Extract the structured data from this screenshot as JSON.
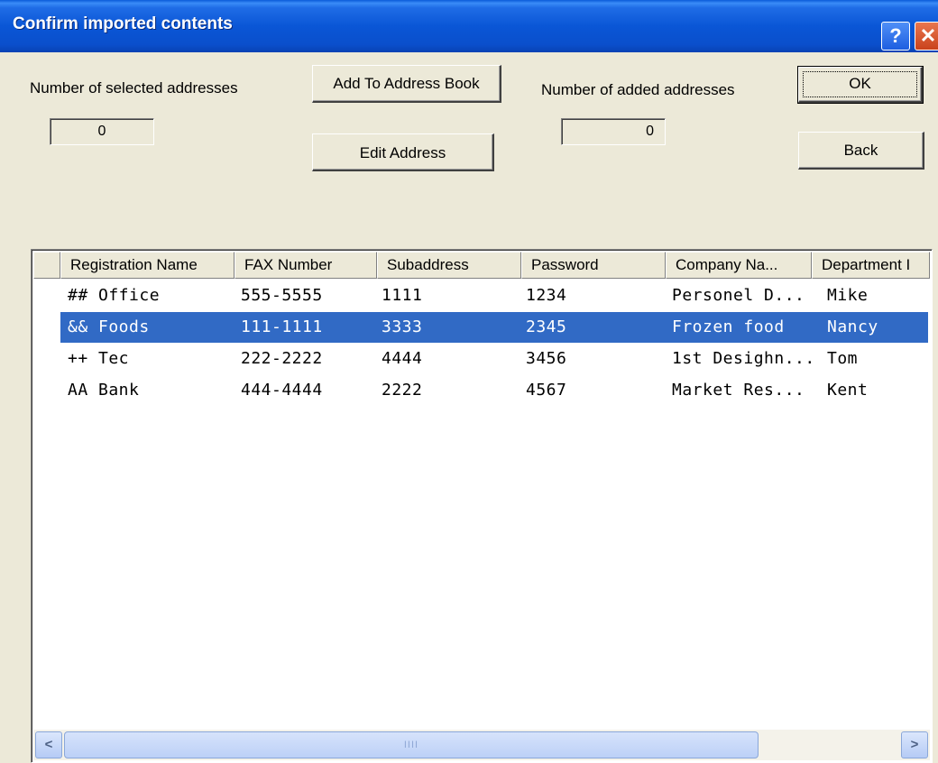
{
  "window": {
    "title": "Confirm imported contents",
    "help_glyph": "?",
    "close_glyph": "✕"
  },
  "labels": {
    "selected": "Number of selected addresses",
    "added": "Number of added addresses"
  },
  "counts": {
    "selected": "0",
    "added": "0"
  },
  "buttons": {
    "add": "Add To Address Book",
    "edit": "Edit Address",
    "ok": "OK",
    "back": "Back"
  },
  "table": {
    "columns": [
      "Registration Name",
      "FAX Number",
      "Subaddress",
      "Password",
      "Company Na...",
      "Department I"
    ],
    "rows": [
      {
        "name": "## Office",
        "fax": "555-5555",
        "sub": "1111",
        "pass": "1234",
        "company": "Personel D...",
        "dept": "Mike",
        "selected": false
      },
      {
        "name": "&& Foods",
        "fax": "111-1111",
        "sub": "3333",
        "pass": "2345",
        "company": "Frozen food",
        "dept": "Nancy",
        "selected": true
      },
      {
        "name": "++ Tec",
        "fax": "222-2222",
        "sub": "4444",
        "pass": "3456",
        "company": "1st Desighn...",
        "dept": "Tom",
        "selected": false
      },
      {
        "name": "AA Bank",
        "fax": "444-4444",
        "sub": "2222",
        "pass": "4567",
        "company": "Market Res...",
        "dept": "Kent",
        "selected": false
      }
    ]
  },
  "scrollbar": {
    "left_glyph": "<",
    "right_glyph": ">",
    "grip": "IIII"
  },
  "colors": {
    "title_bar": "#0a56d6",
    "selection": "#316ac5",
    "dialog_bg": "#ece9d8"
  },
  "icons": [
    "help-icon",
    "close-icon",
    "scroll-left-icon",
    "scroll-right-icon"
  ]
}
